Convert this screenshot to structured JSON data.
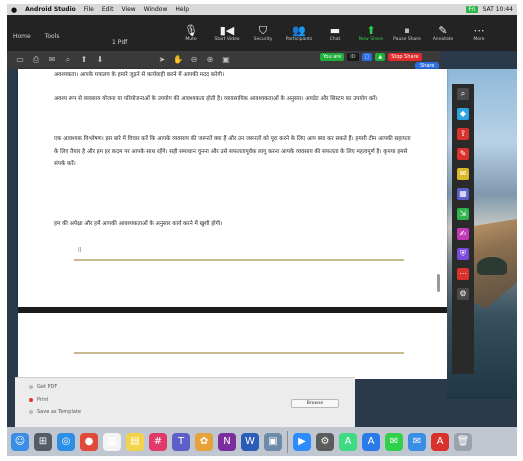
{
  "menubar": {
    "apple": "",
    "app_name": "Android Studio",
    "items": [
      "File",
      "Edit",
      "View",
      "Window",
      "Help"
    ],
    "right": "SAT 10:44",
    "badge": "Fri"
  },
  "zoom_toolbar": {
    "tabs": [
      "Home",
      "Tools"
    ],
    "doc_title": "1 Pdf",
    "tools": [
      {
        "label": "Mute",
        "icon": "microphone-icon"
      },
      {
        "label": "Start Video",
        "icon": "video-icon"
      },
      {
        "label": "Security",
        "icon": "shield-icon"
      },
      {
        "label": "Participants",
        "icon": "participants-icon"
      },
      {
        "label": "Chat",
        "icon": "chat-icon"
      },
      {
        "label": "New Share",
        "icon": "share-icon",
        "highlight": true
      },
      {
        "label": "Pause Share",
        "icon": "pause-icon"
      },
      {
        "label": "Annotate",
        "icon": "pencil-icon"
      },
      {
        "label": "More",
        "icon": "more-icon"
      }
    ]
  },
  "share_status": {
    "sharing": "You are",
    "stop": "Stop Share",
    "id_label": "ID"
  },
  "pause_share_label": "Share",
  "document": {
    "p0": "अवश्यकता। आपके मत्रालय के हमारे जुड़ने से कार्यवाही करने में आपकी मदद करेगी।",
    "p1": "अवश्य रूप से व्यवसाय योजना या परियोजनाओं के उपयोग की आवश्यकता होती है। व्यावसायिक आवश्यकताओं के अनुसार। अपडेट और सिस्टम का उपयोग करें।",
    "p2": "एक आवश्यक विश्लेषण। इस बारे में विचार करें कि आपके व्यवसाय की जरूरतें क्या हैं और उन जरूरतों को पूरा करने के लिए आप क्या कर सकते हैं। हमारी टीम आपकी सहायता के लिए तैयार है और हम हर कदम पर आपके साथ रहेंगे। सही समाधान चुनना और उसे सफलतापूर्वक लागू करना आपके व्यवसाय की सफलता के लिए महत्वपूर्ण है। कृपया हमसे संपर्क करें।",
    "p3": "हम की अपेक्षा और हमें आपकी आवश्यकताओं के अनुसार कार्य करने में खुशी होगी।",
    "caret": "||"
  },
  "dialog": {
    "rows": [
      "Get PDF",
      "Print",
      "Save as Template"
    ],
    "button": "Browse"
  },
  "dock_icons": [
    {
      "name": "finder-icon",
      "color": "#3a8ee6",
      "glyph": "☺"
    },
    {
      "name": "launchpad-icon",
      "color": "#555c66",
      "glyph": "⊞"
    },
    {
      "name": "safari-icon",
      "color": "#2b8fe6",
      "glyph": "◎"
    },
    {
      "name": "chrome-icon",
      "color": "#e04a3a",
      "glyph": "●"
    },
    {
      "name": "calendar-icon",
      "color": "#f4f4f4",
      "glyph": "▦"
    },
    {
      "name": "notes-icon",
      "color": "#f3d34a",
      "glyph": "▤"
    },
    {
      "name": "slack-icon",
      "color": "#e03a6a",
      "glyph": "#"
    },
    {
      "name": "teams-icon",
      "color": "#5b5fc7",
      "glyph": "T"
    },
    {
      "name": "photos-icon",
      "color": "#e8a23a",
      "glyph": "✿"
    },
    {
      "name": "onenote-icon",
      "color": "#7b2d9e",
      "glyph": "N"
    },
    {
      "name": "word-icon",
      "color": "#2b5cb8",
      "glyph": "W"
    },
    {
      "name": "preview-icon",
      "color": "#6d8aa6",
      "glyph": "▣"
    },
    {
      "name": "separator",
      "color": "",
      "glyph": ""
    },
    {
      "name": "zoom-icon",
      "color": "#2d8cff",
      "glyph": "▶"
    },
    {
      "name": "system-preferences-icon",
      "color": "#5c5c5c",
      "glyph": "⚙"
    },
    {
      "name": "android-studio-icon",
      "color": "#3ddc84",
      "glyph": "A"
    },
    {
      "name": "appstore-icon",
      "color": "#2a7bea",
      "glyph": "A"
    },
    {
      "name": "messages-icon",
      "color": "#2fd14b",
      "glyph": "✉"
    },
    {
      "name": "mail-icon",
      "color": "#3a8ee6",
      "glyph": "✉"
    },
    {
      "name": "acrobat-icon",
      "color": "#d9312b",
      "glyph": "A"
    },
    {
      "name": "trash-icon",
      "color": "#9aa3ad",
      "glyph": "🗑"
    }
  ],
  "right_panel_icons": [
    {
      "name": "search-icon",
      "color": "#4a4a4a"
    },
    {
      "name": "shapes-icon",
      "color": "#2aa5e0"
    },
    {
      "name": "export-pdf-icon",
      "color": "#d9312b"
    },
    {
      "name": "edit-pdf-icon",
      "color": "#d9312b"
    },
    {
      "name": "comment-icon",
      "color": "#d9b82b"
    },
    {
      "name": "organize-pages-icon",
      "color": "#5b5fc7"
    },
    {
      "name": "compress-icon",
      "color": "#2fb34a"
    },
    {
      "name": "fill-sign-icon",
      "color": "#c23ab3"
    },
    {
      "name": "protect-icon",
      "color": "#7b4ad9"
    },
    {
      "name": "more-tools-icon",
      "color": "#d9312b"
    },
    {
      "name": "settings-icon",
      "color": "#4a4a4a"
    }
  ]
}
